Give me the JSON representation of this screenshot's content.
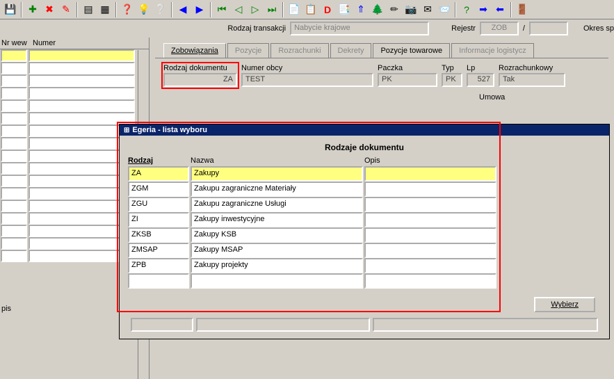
{
  "toolbar_icons": [
    "save",
    "add",
    "delete",
    "clear",
    "grid1",
    "grid2",
    "help",
    "tip",
    "refresh",
    "left",
    "right",
    "first",
    "prev-green",
    "play",
    "next-green",
    "last",
    "doc1",
    "doc2",
    "d-red",
    "doc3",
    "arrow-up",
    "tree",
    "pencil",
    "camera",
    "mail",
    "envelope",
    "question",
    "right2",
    "left2",
    "exit"
  ],
  "trx": {
    "label_rodzaj": "Rodzaj transakcji",
    "rodzaj_value": "Nabycie krajowe",
    "label_rejestr": "Rejestr",
    "rejestr_value": "ZOB",
    "slash": "/",
    "okres_label": "Okres sp"
  },
  "left": {
    "h1": "Nr wew",
    "h2": "Numer",
    "pis_label": "pis"
  },
  "tabs": [
    {
      "label": "Zobowiązania",
      "state": "active"
    },
    {
      "label": "Pozycje",
      "state": "dim"
    },
    {
      "label": "Rozrachunki",
      "state": "dim"
    },
    {
      "label": "Dekrety",
      "state": "dim"
    },
    {
      "label": "Pozycje towarowe",
      "state": ""
    },
    {
      "label": "Informacje logistycz",
      "state": "dim"
    }
  ],
  "form": {
    "rodzaj_label": "Rodzaj dokumentu",
    "rodzaj_value": "ZA",
    "numer_label": "Numer obcy",
    "numer_value": "TEST",
    "paczka_label": "Paczka",
    "paczka_value": "PK",
    "typ_label": "Typ",
    "typ_value": "PK",
    "lp_label": "Lp",
    "lp_value": "527",
    "rozr_label": "Rozrachunkowy",
    "rozr_value": "Tak",
    "umowa_label": "Umowa"
  },
  "popup": {
    "title": "Egeria - lista wyboru",
    "header": "Rodzaje dokumentu",
    "col1": "Rodzaj",
    "col2": "Nazwa",
    "col3": "Opis",
    "rows": [
      {
        "rodzaj": "ZA",
        "nazwa": "Zakupy",
        "opis": "",
        "sel": true
      },
      {
        "rodzaj": "ZGM",
        "nazwa": "Zakupu zagraniczne Materiały",
        "opis": ""
      },
      {
        "rodzaj": "ZGU",
        "nazwa": "Zakupu zagraniczne Usługi",
        "opis": ""
      },
      {
        "rodzaj": "ZI",
        "nazwa": "Zakupy inwestycyjne",
        "opis": ""
      },
      {
        "rodzaj": "ZKSB",
        "nazwa": "Zakupy KSB",
        "opis": ""
      },
      {
        "rodzaj": "ZMSAP",
        "nazwa": "Zakupy MSAP",
        "opis": ""
      },
      {
        "rodzaj": "ZPB",
        "nazwa": "Zakupy projekty",
        "opis": ""
      },
      {
        "rodzaj": "",
        "nazwa": "",
        "opis": ""
      }
    ],
    "btn": "Wybierz"
  }
}
